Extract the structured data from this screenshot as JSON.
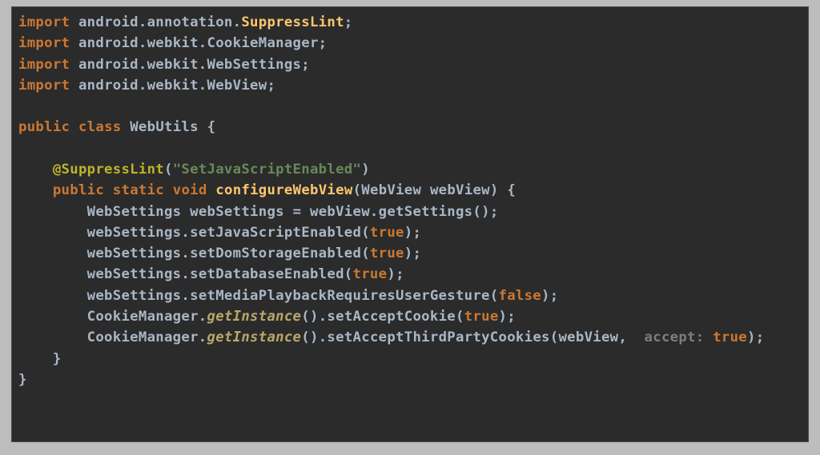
{
  "code": {
    "kw_import": "import",
    "kw_public": "public",
    "kw_class": "class",
    "kw_static": "static",
    "kw_void": "void",
    "pkg_annotation": "android.annotation.",
    "pkg_webkit_cookie": "android.webkit.CookieManager",
    "pkg_webkit_settings": "android.webkit.WebSettings",
    "pkg_webkit_webview": "android.webkit.WebView",
    "cls_suppresslint": "SuppressLint",
    "cls_name": "WebUtils",
    "ann_suppress": "@SuppressLint",
    "str_setjs": "\"SetJavaScriptEnabled\"",
    "m_configure": "configureWebView",
    "type_webview": "WebView",
    "param_webview": "webView",
    "type_websettings": "WebSettings",
    "var_websettings": "webSettings",
    "call_getsettings": "getSettings",
    "call_setjs": "setJavaScriptEnabled",
    "call_setdom": "setDomStorageEnabled",
    "call_setdb": "setDatabaseEnabled",
    "call_setmedia": "setMediaPlaybackRequiresUserGesture",
    "cls_cookiemgr": "CookieManager",
    "call_getinstance": "getInstance",
    "call_setaccept": "setAcceptCookie",
    "call_setthird": "setAcceptThirdPartyCookies",
    "hint_accept": "accept:",
    "bool_true": "true",
    "bool_false": "false",
    "semi": ";",
    "lbrace": "{",
    "rbrace": "}",
    "lparen": "(",
    "rparen": ")",
    "eq": " = ",
    "dot": ".",
    "comma": ",",
    "sp": " ",
    "sp2": "  ",
    "indent1": "    ",
    "indent2": "        "
  }
}
